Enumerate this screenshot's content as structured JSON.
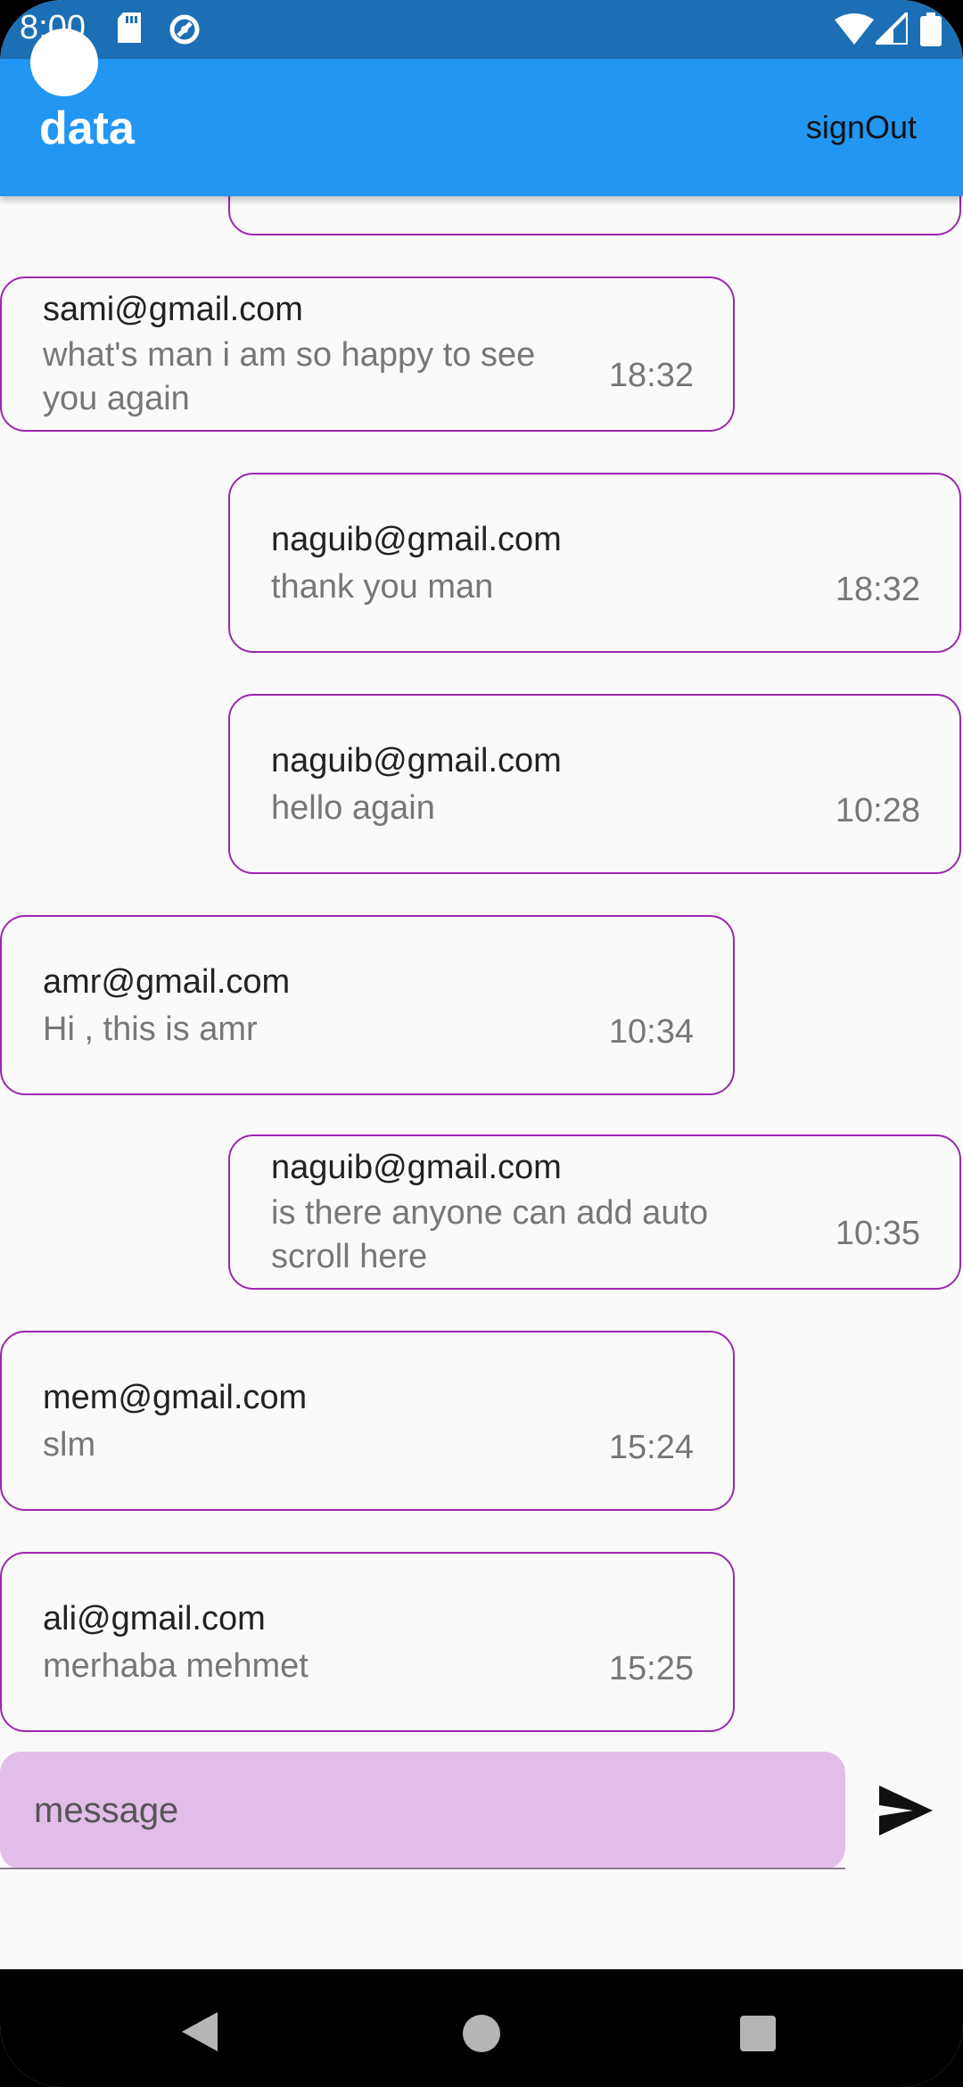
{
  "status_bar": {
    "time": "8:00"
  },
  "app_bar": {
    "title": "data",
    "signout_label": "signOut"
  },
  "messages": [
    {
      "sender": "sami@gmail.com",
      "text": "what's man i am so happy to see you again",
      "time": "18:32",
      "side": "left"
    },
    {
      "sender": "naguib@gmail.com",
      "text": "thank you man",
      "time": "18:32",
      "side": "right"
    },
    {
      "sender": "naguib@gmail.com",
      "text": "hello again",
      "time": "10:28",
      "side": "right"
    },
    {
      "sender": "amr@gmail.com",
      "text": "Hi , this is amr",
      "time": "10:34",
      "side": "left"
    },
    {
      "sender": "naguib@gmail.com",
      "text": "is there anyone can add auto scroll here",
      "time": "10:35",
      "side": "right"
    },
    {
      "sender": "mem@gmail.com",
      "text": "slm",
      "time": "15:24",
      "side": "left"
    },
    {
      "sender": "ali@gmail.com",
      "text": "merhaba mehmet",
      "time": "15:25",
      "side": "left"
    }
  ],
  "composer": {
    "placeholder": "message"
  },
  "icons": {
    "send": "send-icon",
    "back": "back-icon",
    "home": "home-icon",
    "recents": "recents-icon"
  },
  "colors": {
    "status_bar": "#1c6fb4",
    "app_bar": "#2196f3",
    "bubble_border": "#9c27b0",
    "composer_bg": "#e1bee7"
  }
}
